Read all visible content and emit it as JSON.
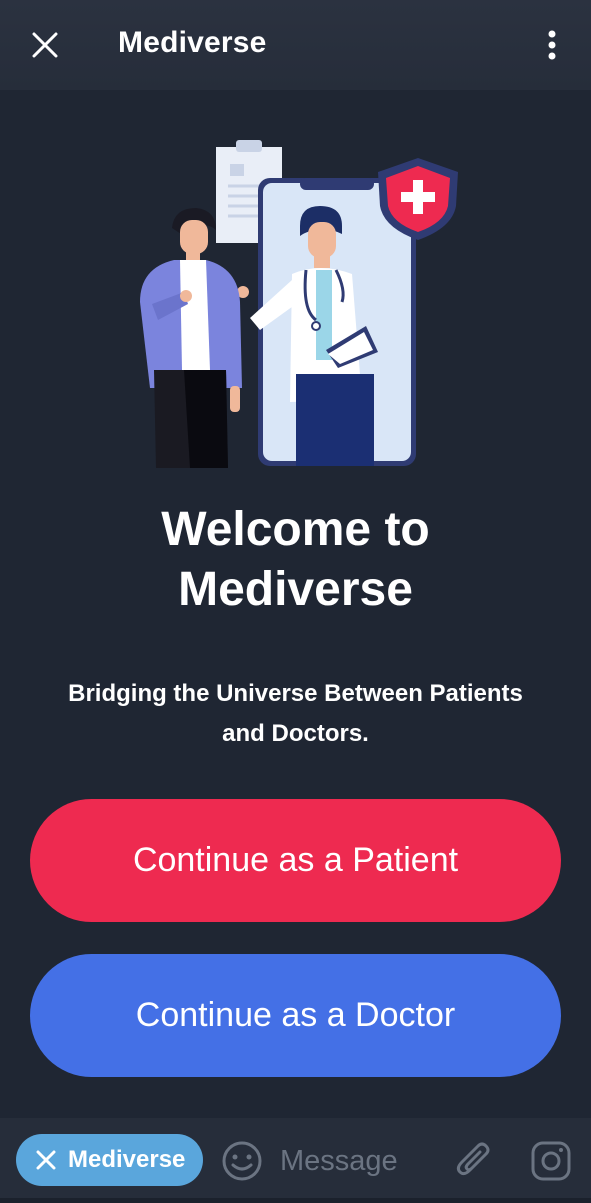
{
  "header": {
    "title": "Mediverse",
    "close_icon": "close-icon",
    "menu_icon": "more-vertical-icon"
  },
  "hero": {
    "illustration": "patient-doctor-illustration"
  },
  "main": {
    "headline_line1": "Welcome to",
    "headline_line2": "Mediverse",
    "tagline_line1": "Bridging the Universe Between Patients",
    "tagline_line2": "and Doctors.",
    "patient_button_label": "Continue as a Patient",
    "doctor_button_label": "Continue as a Doctor"
  },
  "composer": {
    "chip_label": "Mediverse",
    "message_placeholder": "Message"
  },
  "colors": {
    "background": "#1f2633",
    "patient_button": "#ee2a50",
    "doctor_button": "#4470e6",
    "chip": "#5aa6dc"
  }
}
